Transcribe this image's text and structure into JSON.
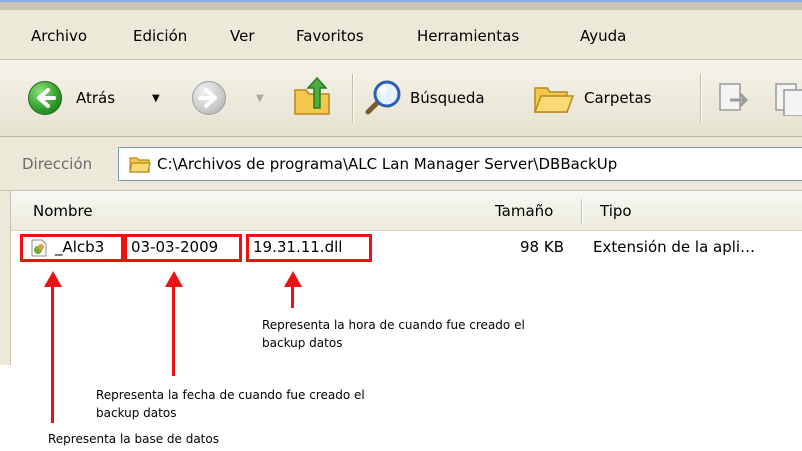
{
  "menu": {
    "items": [
      "Archivo",
      "Edición",
      "Ver",
      "Favoritos",
      "Herramientas",
      "Ayuda"
    ]
  },
  "toolbar": {
    "back_label": "Atrás",
    "search_label": "Búsqueda",
    "folders_label": "Carpetas",
    "icons": [
      "back-arrow-icon",
      "forward-arrow-icon",
      "folder-up-icon",
      "search-magnifier-icon",
      "folders-icon",
      "move-to-icon",
      "copy-to-icon"
    ]
  },
  "address": {
    "label": "Dirección",
    "path": "C:\\Archivos de programa\\ALC Lan Manager Server\\DBBackUp",
    "icon": "folder-icon"
  },
  "columns": {
    "name": "Nombre",
    "size": "Tamaño",
    "type": "Tipo"
  },
  "file": {
    "name_part_db": "_Alcb3",
    "name_part_date": "03-03-2009",
    "name_part_time": "19.31.11.dll",
    "size": "98 KB",
    "type": "Extensión de la apli…",
    "icon": "dll-file-icon"
  },
  "annotations": {
    "time_line1": "Representa la hora de cuando fue creado el",
    "time_line2": "backup datos",
    "date_line1": "Representa la fecha de cuando fue creado el",
    "date_line2": "backup datos",
    "db_line": "Representa la base de datos",
    "highlight_color": "#ee1111"
  }
}
